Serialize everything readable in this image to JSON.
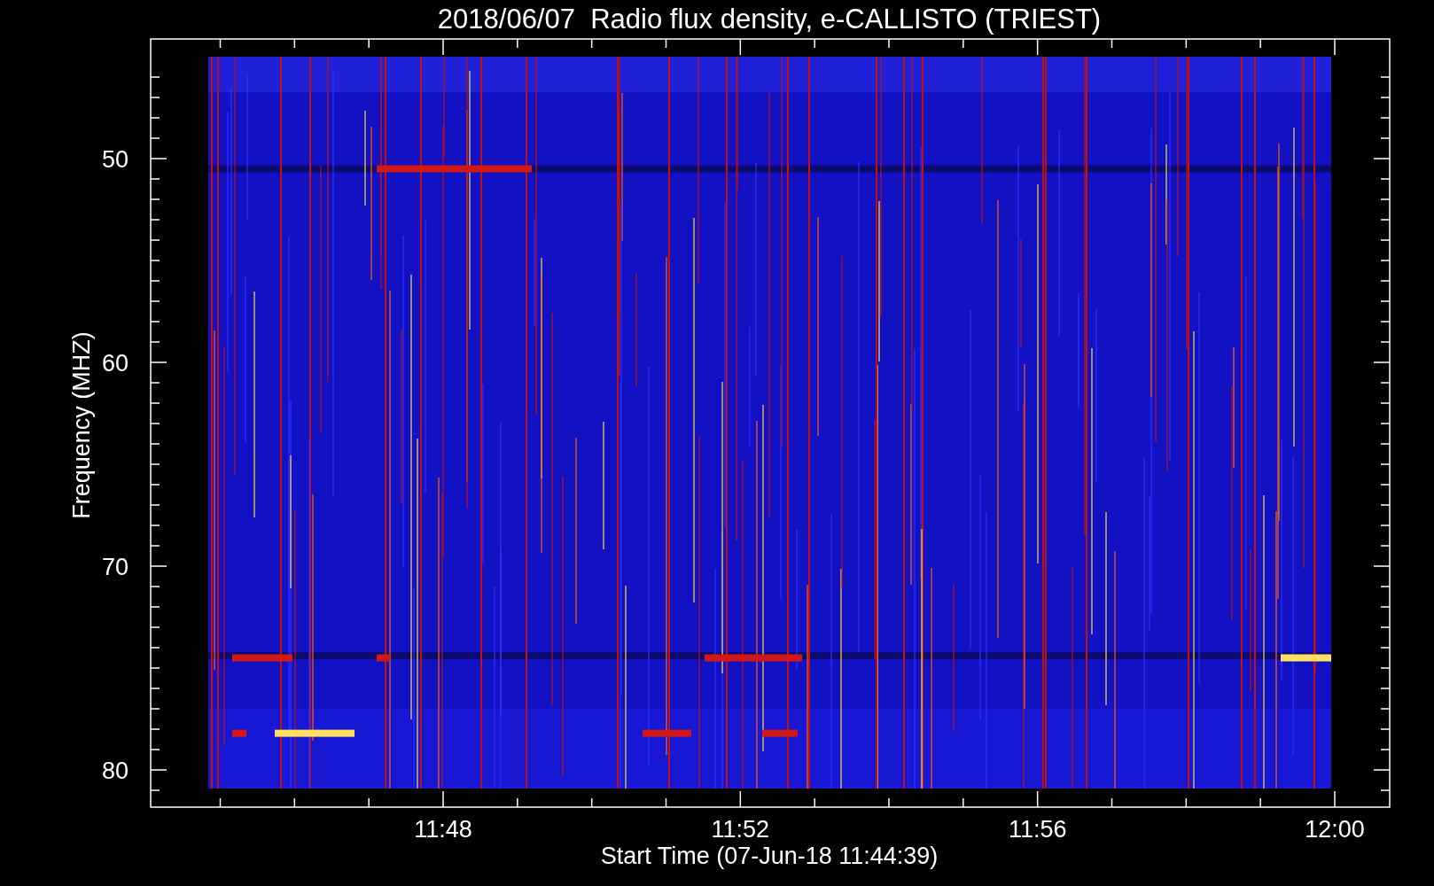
{
  "plot": {
    "title": "2018/06/07  Radio flux density, e-CALLISTO (TRIEST)",
    "ylabel": "Frequency (MHZ)",
    "xlabel": "Start Time (07-Jun-18 11:44:39)",
    "y_tick_labels": [
      "50",
      "60",
      "70",
      "80"
    ],
    "x_tick_labels": [
      "11:48",
      "11:52",
      "11:56",
      "12:00"
    ]
  }
}
